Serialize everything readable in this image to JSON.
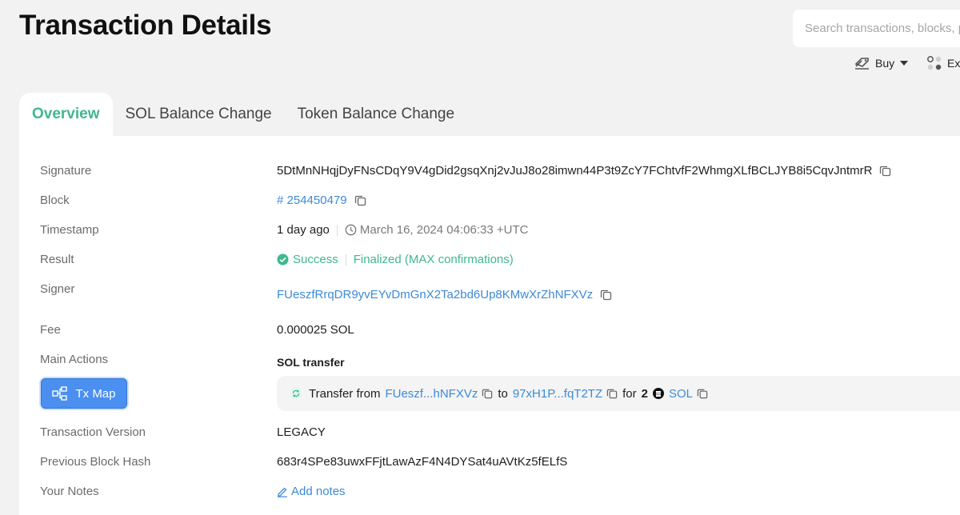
{
  "header": {
    "title": "Transaction Details",
    "search_placeholder": "Search transactions, blocks, programs and tokens",
    "buy_label": "Buy",
    "exchange_label": "Exchange"
  },
  "tabs": [
    {
      "label": "Overview",
      "active": true
    },
    {
      "label": "SOL Balance Change",
      "active": false
    },
    {
      "label": "Token Balance Change",
      "active": false
    }
  ],
  "details": {
    "signature": {
      "label": "Signature",
      "value": "5DtMnNHqjDyFNsCDqY9V4gDid2gsqXnj2vJuJ8o28imwn44P3t9ZcY7FChtvfF2WhmgXLfBCLJYB8i5CqvJntmrR"
    },
    "block": {
      "label": "Block",
      "value": "# 254450479"
    },
    "timestamp": {
      "label": "Timestamp",
      "relative": "1 day ago",
      "absolute": "March 16, 2024 04:06:33 +UTC"
    },
    "result": {
      "label": "Result",
      "status": "Success",
      "confirmation": "Finalized (MAX confirmations)"
    },
    "signer": {
      "label": "Signer",
      "value": "FUeszfRrqDR9yvEYvDmGnX2Ta2bd6Up8KMwXrZhNFXVz"
    },
    "fee": {
      "label": "Fee",
      "value": "0.000025 SOL"
    },
    "main_actions": {
      "label": "Main Actions",
      "tx_map_label": "Tx Map",
      "action_title": "SOL transfer",
      "transfer_from_text": "Transfer from",
      "from_address": "FUeszf...hNFXVz",
      "to_text": "to",
      "to_address": "97xH1P...fqT2TZ",
      "for_text": "for",
      "amount": "2",
      "token": "SOL"
    },
    "transaction_version": {
      "label": "Transaction Version",
      "value": "LEGACY"
    },
    "previous_block_hash": {
      "label": "Previous Block Hash",
      "value": "683r4SPe83uwxFFjtLawAzF4N4DYSat4uAVtKz5fELfS"
    },
    "your_notes": {
      "label": "Your Notes",
      "add_label": "Add notes"
    }
  },
  "colors": {
    "accent_green": "#3fb88d",
    "link_blue": "#3d8ad8",
    "button_blue": "#4b8ff0"
  }
}
